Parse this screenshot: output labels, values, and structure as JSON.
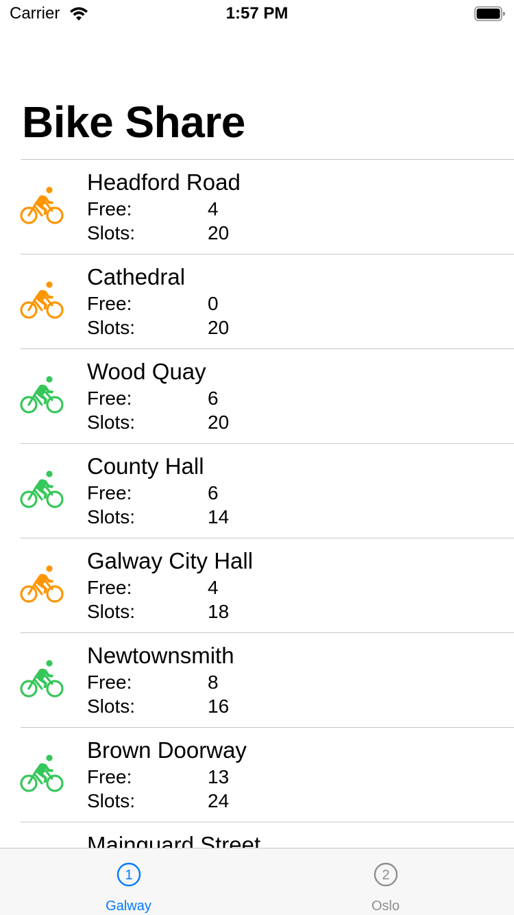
{
  "status_bar": {
    "carrier": "Carrier",
    "time": "1:57 PM"
  },
  "nav": {
    "title": "Bike Share"
  },
  "labels": {
    "free": "Free:",
    "slots": "Slots:"
  },
  "colors": {
    "available": "#34c759",
    "low": "#ff9500",
    "tab_active": "#007aff",
    "tab_inactive": "#8e8e93"
  },
  "stations": [
    {
      "name": "Headford Road",
      "free": "4",
      "slots": "20",
      "status": "low",
      "icon": "bicycle-icon"
    },
    {
      "name": "Cathedral",
      "free": "0",
      "slots": "20",
      "status": "low",
      "icon": "bicycle-icon"
    },
    {
      "name": "Wood Quay",
      "free": "6",
      "slots": "20",
      "status": "available",
      "icon": "bicycle-icon"
    },
    {
      "name": "County Hall",
      "free": "6",
      "slots": "14",
      "status": "available",
      "icon": "bicycle-icon"
    },
    {
      "name": "Galway City Hall",
      "free": "4",
      "slots": "18",
      "status": "low",
      "icon": "bicycle-icon"
    },
    {
      "name": "Newtownsmith",
      "free": "8",
      "slots": "16",
      "status": "available",
      "icon": "bicycle-icon"
    },
    {
      "name": "Brown Doorway",
      "free": "13",
      "slots": "24",
      "status": "available",
      "icon": "bicycle-icon"
    },
    {
      "name": "Mainguard Street",
      "free": "",
      "slots": "",
      "status": "available",
      "icon": "bicycle-icon"
    }
  ],
  "tabs": [
    {
      "label": "Galway",
      "number": "1",
      "selected": true,
      "icon": "circled-number-icon"
    },
    {
      "label": "Oslo",
      "number": "2",
      "selected": false,
      "icon": "circled-number-icon"
    }
  ]
}
